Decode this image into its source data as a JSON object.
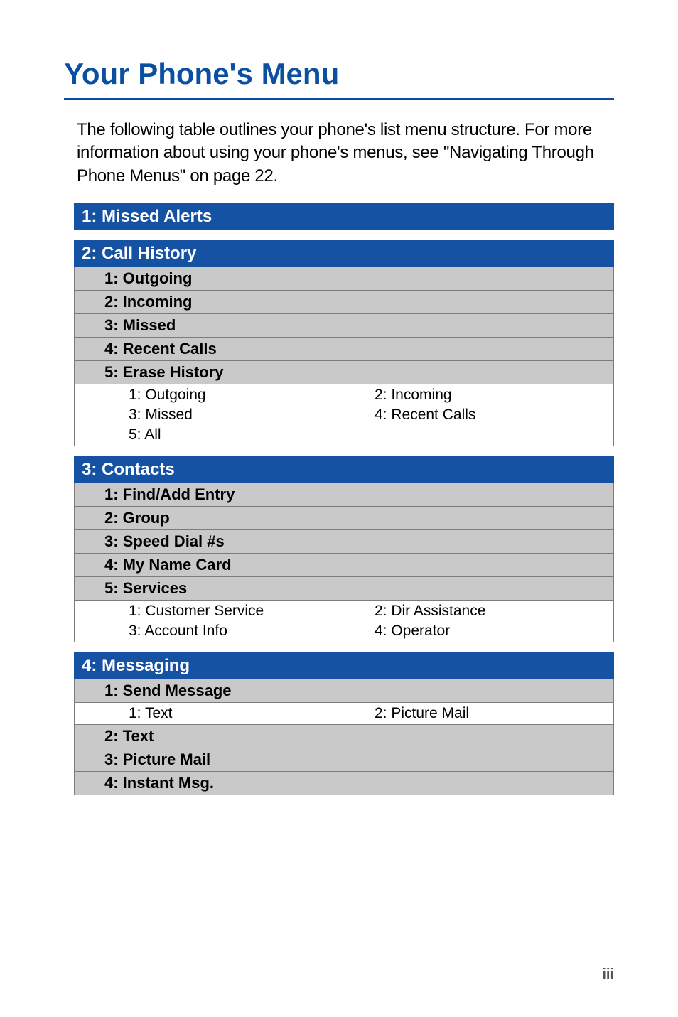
{
  "title": "Your Phone's Menu",
  "intro": "The following table outlines your phone's list menu structure. For more information about using your phone's menus, see \"Navigating Through Phone Menus\" on page 22.",
  "menu": {
    "s1": {
      "header": "1: Missed Alerts"
    },
    "s2": {
      "header": "2: Call History",
      "items": {
        "i1": "1: Outgoing",
        "i2": "2: Incoming",
        "i3": "3: Missed",
        "i4": "4: Recent Calls",
        "i5": "5: Erase History"
      },
      "leaves": {
        "l1": "1: Outgoing",
        "l2": "2: Incoming",
        "l3": "3: Missed",
        "l4": "4: Recent Calls",
        "l5": "5: All"
      }
    },
    "s3": {
      "header": "3: Contacts",
      "items": {
        "i1": "1: Find/Add Entry",
        "i2": "2: Group",
        "i3": "3: Speed Dial #s",
        "i4": "4: My Name Card",
        "i5": "5: Services"
      },
      "leaves": {
        "l1": "1: Customer Service",
        "l2": "2: Dir Assistance",
        "l3": "3: Account Info",
        "l4": "4: Operator"
      }
    },
    "s4": {
      "header": "4: Messaging",
      "items": {
        "i1": "1: Send Message",
        "i2": "2: Text",
        "i3": "3: Picture Mail",
        "i4": "4: Instant Msg."
      },
      "leaves": {
        "l1": "1: Text",
        "l2": "2: Picture Mail"
      }
    }
  },
  "pagenum": "iii"
}
